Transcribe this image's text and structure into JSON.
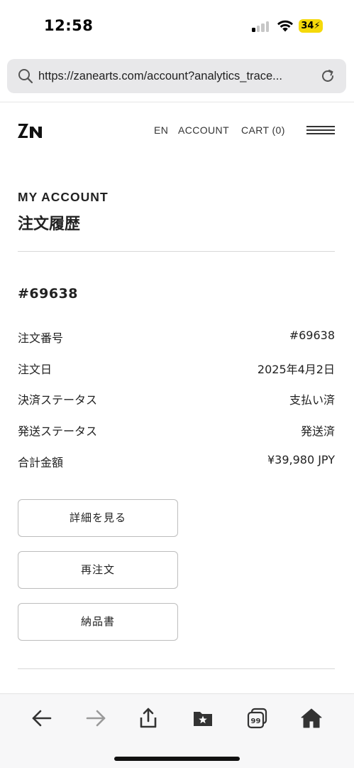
{
  "status": {
    "time": "12:58",
    "battery": "34"
  },
  "browser": {
    "url": "https://zanearts.com/account?analytics_trace..."
  },
  "header": {
    "nav": {
      "lang": "EN",
      "account": "ACCOUNT",
      "cart": "CART (0)"
    }
  },
  "page": {
    "eyebrow": "MY ACCOUNT",
    "title": "注文履歴"
  },
  "order": {
    "heading": "#69638",
    "rows": [
      {
        "label": "注文番号",
        "value": "#69638"
      },
      {
        "label": "注文日",
        "value": "2025年4月2日"
      },
      {
        "label": "決済ステータス",
        "value": "支払い済"
      },
      {
        "label": "発送ステータス",
        "value": "発送済"
      },
      {
        "label": "合計金額",
        "value": "¥39,980 JPY"
      }
    ],
    "buttons": {
      "details": "詳細を見る",
      "reorder": "再注文",
      "invoice": "納品書"
    }
  },
  "toolbar": {
    "tabs_count": "99"
  },
  "colors": {
    "battery": "#f5d90a",
    "url_bar": "#e8e8ea",
    "toolbar_active": "#333333",
    "toolbar_disabled": "#9a9a9a"
  }
}
